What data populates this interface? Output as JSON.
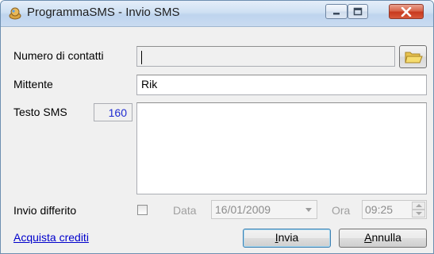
{
  "window": {
    "title": "ProgrammaSMS - Invio SMS",
    "icon": "app-icon",
    "controls": [
      "minimize-icon",
      "maximize-icon",
      "close-icon"
    ]
  },
  "form": {
    "contacts_label": "Numero di contatti",
    "contacts_value": "",
    "sender_label": "Mittente",
    "sender_value": "Rik",
    "sms_label": "Testo SMS",
    "sms_counter": "160",
    "sms_value": "",
    "deferred_label": "Invio differito",
    "deferred_checked": false,
    "date_label": "Data",
    "date_value": "16/01/2009",
    "time_label": "Ora",
    "time_value": "09:25"
  },
  "footer": {
    "buy_link": "Acquista crediti",
    "send_prefix": "I",
    "send_rest": "nvia",
    "cancel_prefix": "A",
    "cancel_rest": "nnulla"
  },
  "colors": {
    "counter_text": "#1f2bd1",
    "link": "#0000cc",
    "close_button": "#c8391e"
  }
}
